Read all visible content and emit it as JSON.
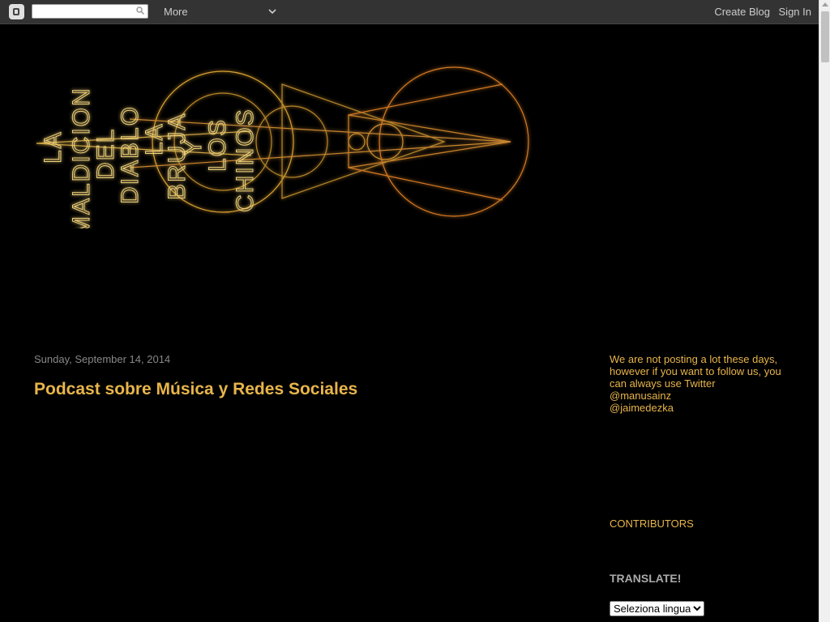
{
  "navbar": {
    "search_value": "",
    "more_label": "More",
    "create_blog_label": "Create Blog",
    "sign_in_label": "Sign In"
  },
  "header": {
    "logo_text_lines": [
      "LA",
      "MALDICION",
      "DEL",
      "DIABLO",
      "LA",
      "BRUJA",
      "Y",
      "LOS",
      "CHINOS"
    ]
  },
  "post": {
    "date": "Sunday, September 14, 2014",
    "title": "Podcast sobre Música y Redes Sociales"
  },
  "sidebar": {
    "message_lines": [
      "We are not posting a lot these days,",
      "however if you want to follow us, you",
      "can always use Twitter",
      "@manusainz",
      "@jaimedezka"
    ],
    "contributors_label": "CONTRIBUTORS",
    "translate_label": "TRANSLATE!",
    "language_select_value": "Seleziona lingua"
  },
  "colors": {
    "accent": "#e8b54a",
    "background": "#000000",
    "navbar": "#333333"
  }
}
